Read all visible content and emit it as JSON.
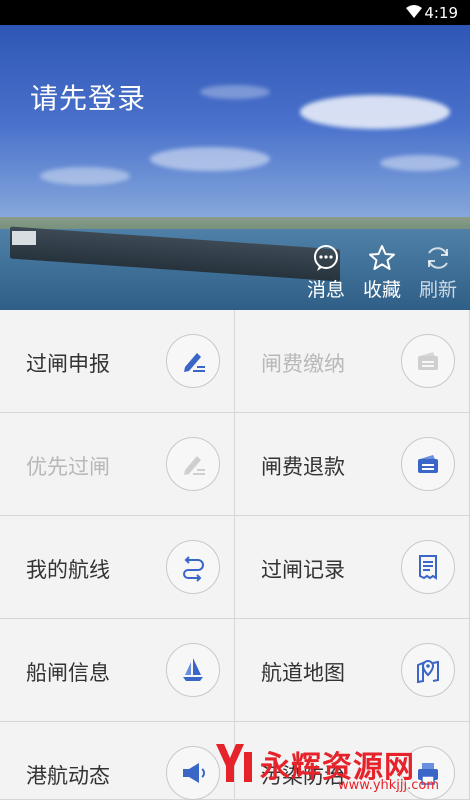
{
  "status_bar": {
    "time": "4:19"
  },
  "header": {
    "login_text": "请先登录",
    "actions": [
      {
        "label": "消息",
        "icon": "chat-bubble-icon"
      },
      {
        "label": "收藏",
        "icon": "star-icon"
      },
      {
        "label": "刷新",
        "icon": "refresh-icon"
      }
    ]
  },
  "menu": [
    {
      "label": "过闸申报",
      "icon": "edit-pen-icon",
      "enabled": true
    },
    {
      "label": "闸费缴纳",
      "icon": "card-payment-icon",
      "enabled": false
    },
    {
      "label": "优先过闸",
      "icon": "edit-pen-icon",
      "enabled": false
    },
    {
      "label": "闸费退款",
      "icon": "card-refund-icon",
      "enabled": true
    },
    {
      "label": "我的航线",
      "icon": "route-arrows-icon",
      "enabled": true
    },
    {
      "label": "过闸记录",
      "icon": "receipt-icon",
      "enabled": true
    },
    {
      "label": "船闸信息",
      "icon": "sailboat-icon",
      "enabled": true
    },
    {
      "label": "航道地图",
      "icon": "map-pin-icon",
      "enabled": true
    },
    {
      "label": "港航动态",
      "icon": "megaphone-icon",
      "enabled": true
    },
    {
      "label": "污染防治",
      "icon": "printer-icon",
      "enabled": true
    }
  ],
  "watermark": {
    "text": "永辉资源网",
    "url": "www.yhkjjj.com"
  },
  "colors": {
    "accent": "#3a66c8",
    "disabled": "#b8b8b8",
    "watermark": "#e6232a"
  }
}
